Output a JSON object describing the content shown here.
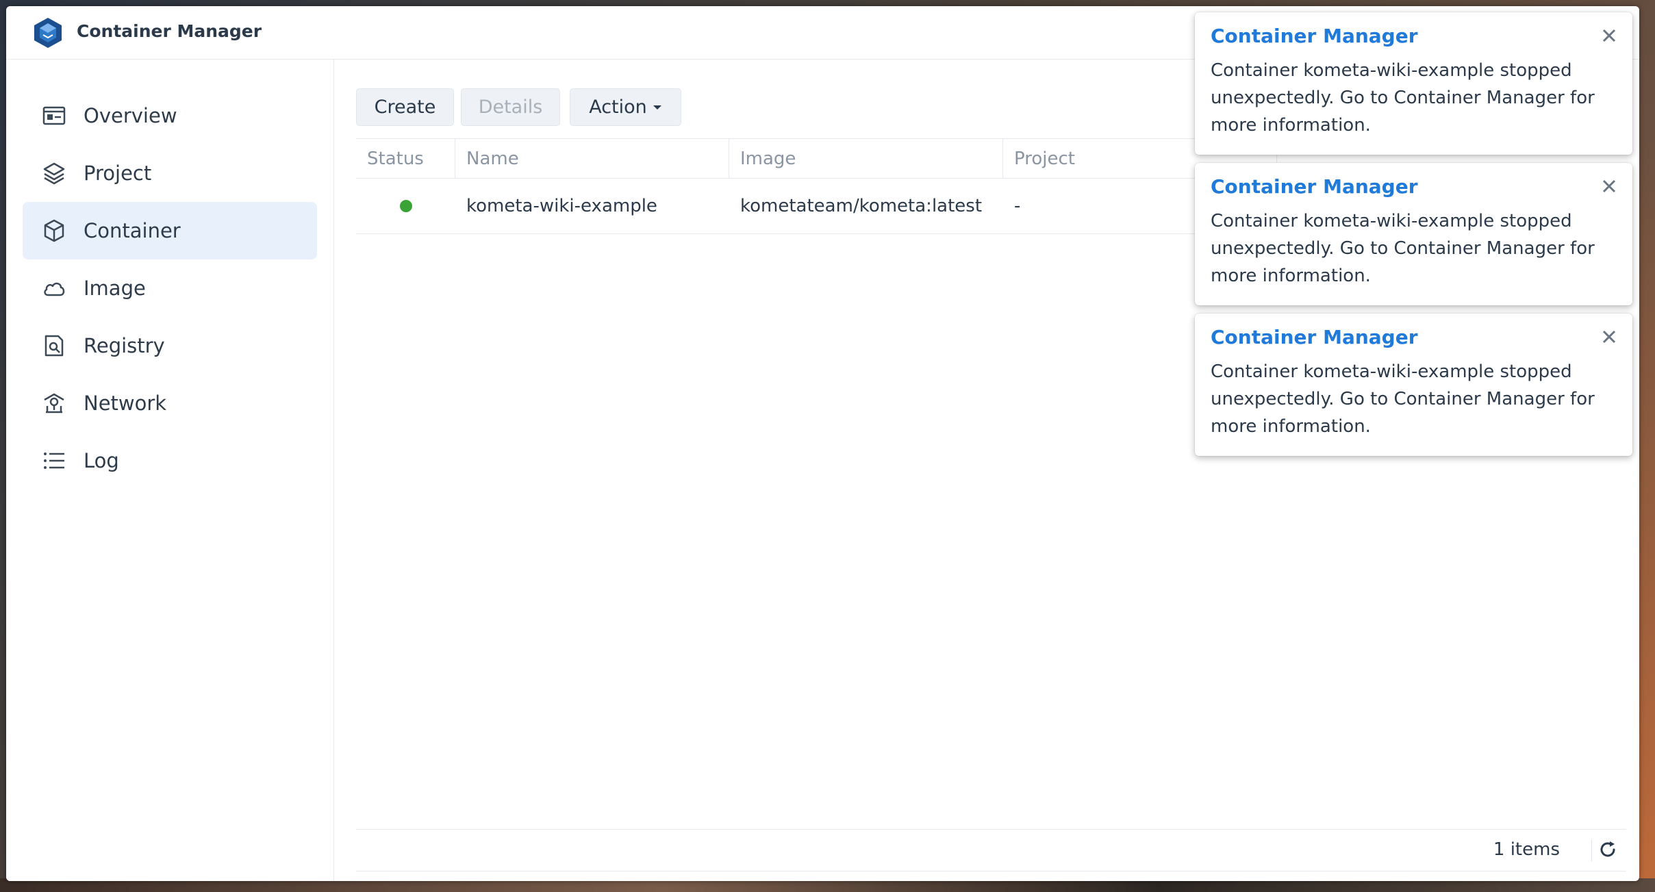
{
  "window": {
    "title": "Container Manager"
  },
  "sidebar": {
    "items": [
      {
        "label": "Overview",
        "icon": "overview-icon",
        "active": false
      },
      {
        "label": "Project",
        "icon": "project-icon",
        "active": false
      },
      {
        "label": "Container",
        "icon": "container-icon",
        "active": true
      },
      {
        "label": "Image",
        "icon": "image-cloud-icon",
        "active": false
      },
      {
        "label": "Registry",
        "icon": "registry-icon",
        "active": false
      },
      {
        "label": "Network",
        "icon": "network-icon",
        "active": false
      },
      {
        "label": "Log",
        "icon": "log-list-icon",
        "active": false
      }
    ]
  },
  "toolbar": {
    "create_label": "Create",
    "details_label": "Details",
    "action_label": "Action"
  },
  "table": {
    "columns": [
      "Status",
      "Name",
      "Image",
      "Project"
    ],
    "rows": [
      {
        "status": "running",
        "name": "kometa-wiki-example",
        "image": "kometateam/kometa:latest",
        "project": "-"
      }
    ]
  },
  "footer": {
    "count_label": "1 items"
  },
  "notifications": [
    {
      "title": "Container Manager",
      "message": "Container kometa-wiki-example stopped unexpectedly. Go to Container Manager for more information."
    },
    {
      "title": "Container Manager",
      "message": "Container kometa-wiki-example stopped unexpectedly. Go to Container Manager for more information."
    },
    {
      "title": "Container Manager",
      "message": "Container kometa-wiki-example stopped unexpectedly. Go to Container Manager for more information."
    }
  ],
  "colors": {
    "accent": "#1f7ad9",
    "status_running": "#3aa335",
    "active_nav_bg": "#e8f1fb"
  }
}
